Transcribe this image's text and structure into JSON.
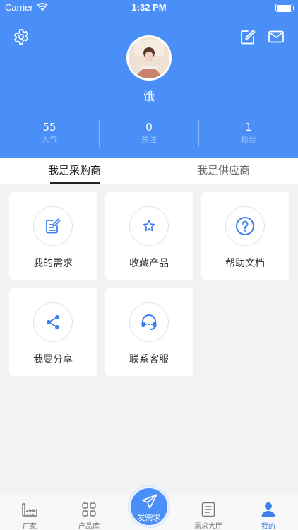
{
  "status_bar": {
    "carrier": "Carrier",
    "time": "1:32 PM"
  },
  "header": {
    "username": "饿"
  },
  "stats": [
    {
      "value": "55",
      "label": "人气"
    },
    {
      "value": "0",
      "label": "关注"
    },
    {
      "value": "1",
      "label": "粉丝"
    }
  ],
  "segments": [
    {
      "label": "我是采购商",
      "active": true
    },
    {
      "label": "我是供应商",
      "active": false
    }
  ],
  "menu": [
    {
      "label": "我的需求",
      "icon": "document-edit-icon"
    },
    {
      "label": "收藏产品",
      "icon": "star-icon"
    },
    {
      "label": "帮助文档",
      "icon": "help-icon"
    },
    {
      "label": "我要分享",
      "icon": "share-icon"
    },
    {
      "label": "联系客服",
      "icon": "headset-icon"
    }
  ],
  "tabbar": {
    "items": [
      {
        "label": "厂家",
        "icon": "factory-icon"
      },
      {
        "label": "产品库",
        "icon": "grid-icon"
      },
      {
        "label": "需求大厅",
        "icon": "list-icon"
      },
      {
        "label": "我的",
        "icon": "profile-icon"
      }
    ],
    "publish_label": "发需求",
    "active_index": 3
  },
  "colors": {
    "primary": "#4a8ff7",
    "icon_blue": "#3b7ff0"
  }
}
